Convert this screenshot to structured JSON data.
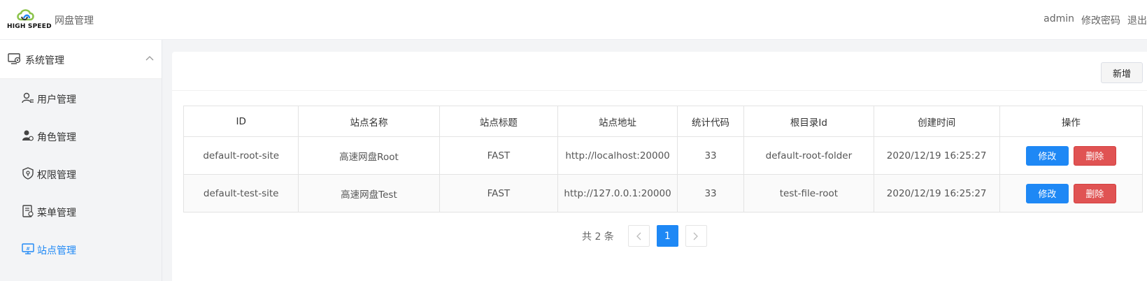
{
  "header": {
    "logo_text": "HIGH SPEED",
    "app_title": "网盘管理",
    "user": "admin",
    "change_password": "修改密码",
    "logout": "退出"
  },
  "sidebar": {
    "group_label": "系统管理",
    "items": [
      {
        "label": "用户管理",
        "icon": "user-list-icon"
      },
      {
        "label": "角色管理",
        "icon": "role-icon"
      },
      {
        "label": "权限管理",
        "icon": "shield-icon"
      },
      {
        "label": "菜单管理",
        "icon": "menu-doc-icon"
      },
      {
        "label": "站点管理",
        "icon": "monitor-icon",
        "active": true
      }
    ]
  },
  "toolbar": {
    "add_label": "新增"
  },
  "table": {
    "columns": [
      "ID",
      "站点名称",
      "站点标题",
      "站点地址",
      "统计代码",
      "根目录Id",
      "创建时间",
      "操作"
    ],
    "rows": [
      [
        "default-root-site",
        "高速网盘Root",
        "FAST",
        "http://localhost:20000",
        "33",
        "default-root-folder",
        "2020/12/19 16:25:27"
      ],
      [
        "default-test-site",
        "高速网盘Test",
        "FAST",
        "http://127.0.0.1:20000",
        "33",
        "test-file-root",
        "2020/12/19 16:25:27"
      ]
    ],
    "edit_label": "修改",
    "delete_label": "删除"
  },
  "pagination": {
    "total_text": "共 2 条",
    "current_page": "1"
  },
  "colors": {
    "accent": "#1e88f5",
    "danger": "#e05353"
  }
}
